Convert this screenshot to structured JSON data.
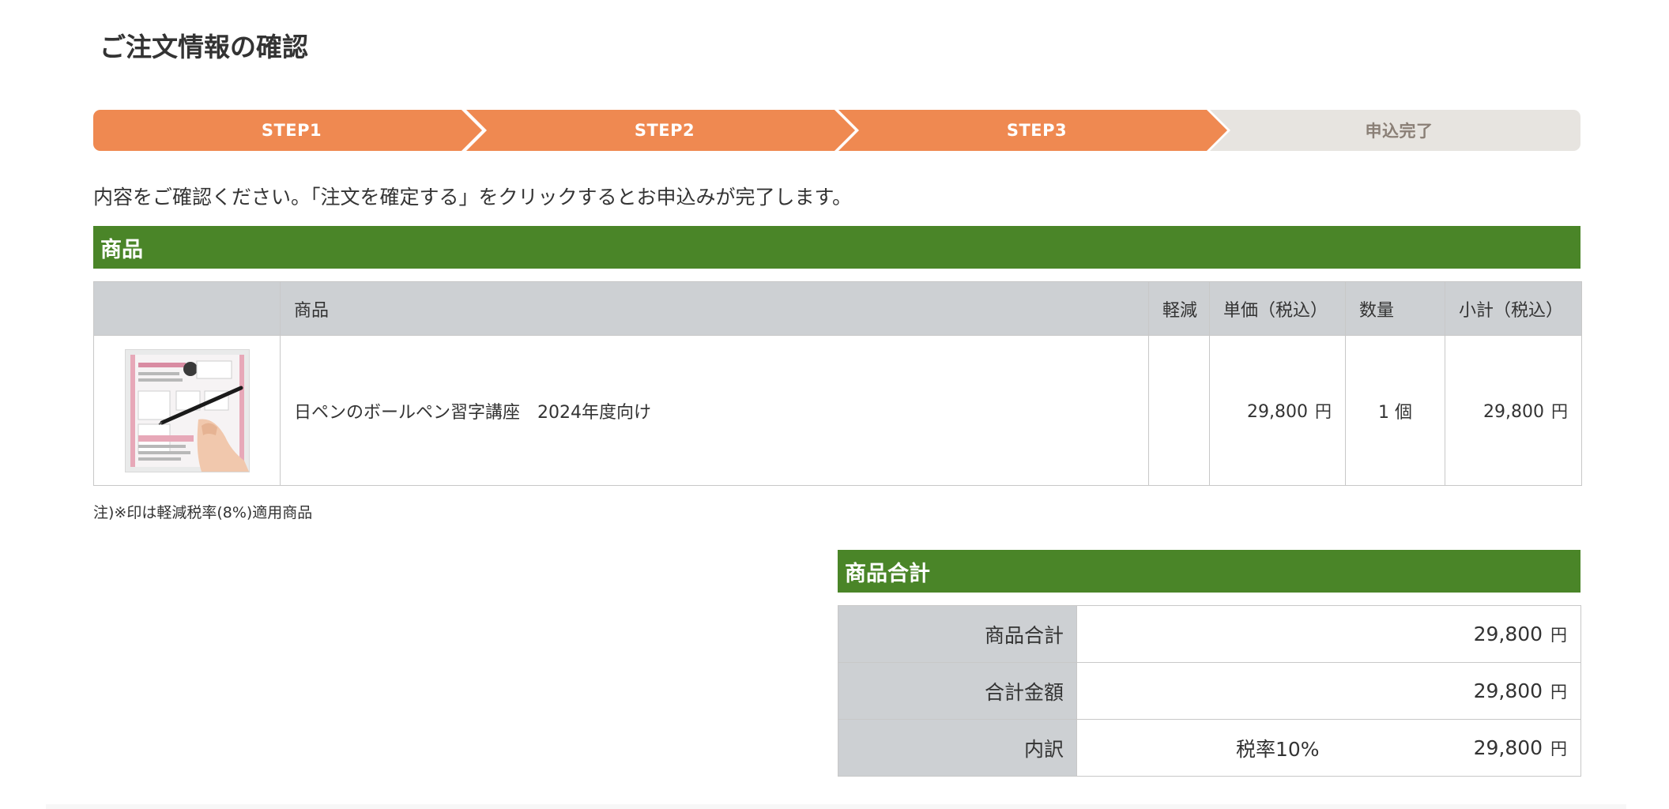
{
  "page": {
    "title": "ご注文情報の確認",
    "instruction": "内容をご確認ください。「注文を確定する」をクリックするとお申込みが完了します。"
  },
  "steps": [
    {
      "label": "STEP1",
      "state": "done"
    },
    {
      "label": "STEP2",
      "state": "done"
    },
    {
      "label": "STEP3",
      "state": "active"
    },
    {
      "label": "申込完了",
      "state": "pending"
    }
  ],
  "products_section": {
    "title": "商品",
    "headers": {
      "image": "",
      "product": "商品",
      "reduced": "軽減",
      "unit_price": "単価（税込）",
      "quantity": "数量",
      "subtotal": "小計（税込）"
    },
    "items": [
      {
        "image_icon": "pen-practice-book-photo",
        "name": "日ペンのボールペン習字講座　2024年度向け",
        "reduced": "",
        "unit_price": "29,800",
        "unit_price_unit": "円",
        "quantity": "1",
        "quantity_unit": "個",
        "subtotal": "29,800",
        "subtotal_unit": "円"
      }
    ],
    "note": "注)※印は軽減税率(8%)適用商品"
  },
  "totals_section": {
    "title": "商品合計",
    "rows": [
      {
        "label": "商品合計",
        "rate": "",
        "value": "29,800",
        "unit": "円"
      },
      {
        "label": "合計金額",
        "rate": "",
        "value": "29,800",
        "unit": "円"
      },
      {
        "label": "内訳",
        "rate": "税率10%",
        "value": "29,800",
        "unit": "円"
      }
    ]
  },
  "colors": {
    "step_active": "#ef8951",
    "step_pending": "#e7e4e0",
    "section_bar": "#4a8528",
    "table_header": "#cdd0d3"
  }
}
